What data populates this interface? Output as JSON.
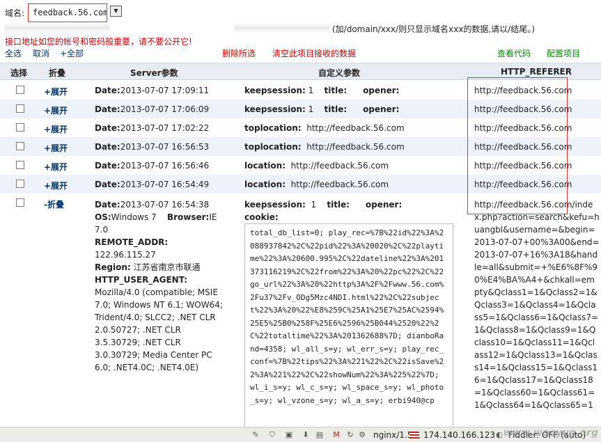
{
  "topbar": {
    "domain_label": "域名:",
    "domain_value": "feedback.56.com",
    "select_icon": "chevron-down-icon"
  },
  "api": {
    "hint": "(加/domain/xxx/则只显示域名xxx的数据,请以/结尾。)"
  },
  "warning": "接口地址如您的帐号和密码般重要，请不要公开它!",
  "actions": {
    "select_all": "全选",
    "cancel": "取消",
    "add_all": "+全部",
    "delete_selected": "删除所选",
    "clear_all": "清空此项目接收的数据",
    "view_code": "查看代码",
    "config": "配置项目"
  },
  "table": {
    "headers": [
      "选择",
      "折叠",
      "Server参数",
      "自定义参数",
      "HTTP_REFERER"
    ],
    "rows": [
      {
        "toggle": "+展开",
        "date_label": "Date:",
        "date": "2013-07-07 17:09:11",
        "custom": [
          [
            "keepsession:",
            "1"
          ],
          [
            "title:",
            ""
          ],
          [
            "opener:",
            ""
          ]
        ],
        "referer": "http://feedback.56.com"
      },
      {
        "toggle": "+展开",
        "date_label": "Date:",
        "date": "2013-07-07 17:06:09",
        "custom": [
          [
            "keepsession:",
            "1"
          ],
          [
            "title:",
            ""
          ],
          [
            "opener:",
            ""
          ]
        ],
        "referer": "http://feedback.56.com"
      },
      {
        "toggle": "+展开",
        "date_label": "Date:",
        "date": "2013-07-07 17:02:22",
        "custom": [
          [
            "toplocation:",
            "http://feedback.56.com"
          ]
        ],
        "referer": "http://feedback.56.com"
      },
      {
        "toggle": "+展开",
        "date_label": "Date:",
        "date": "2013-07-07 16:56:53",
        "custom": [
          [
            "toplocation:",
            "http://feedback.56.com"
          ]
        ],
        "referer": "http://feedback.56.com"
      },
      {
        "toggle": "+展开",
        "date_label": "Date:",
        "date": "2013-07-07 16:56:46",
        "custom": [
          [
            "location:",
            "http://feedback.56.com"
          ]
        ],
        "referer": "http://feedback.56.com"
      },
      {
        "toggle": "+展开",
        "date_label": "Date:",
        "date": "2013-07-07 16:54:49",
        "custom": [
          [
            "location:",
            "http://feedback.56.com"
          ]
        ],
        "referer": "http://feedback.56.com"
      }
    ],
    "expanded": {
      "toggle": "-折叠",
      "date_label": "Date:",
      "date": "2013-07-07 16:54:38",
      "os_label": "OS:",
      "os": "Windows 7",
      "browser_label": "Browser:",
      "browser": "IE 7.0",
      "remote_label": "REMOTE_ADDR:",
      "remote": "122.96.115.27",
      "region_label": "Region:",
      "region": "江苏省南京市联通",
      "ua_label": "HTTP_USER_AGENT:",
      "ua": "Mozilla/4.0 (compatible; MSIE 7.0; Windows NT 6.1; WOW64; Trident/4.0; SLCC2; .NET CLR 2.0.50727; .NET CLR 3.5.30729; .NET CLR 3.0.30729; Media Center PC 6.0; .NET4.0C; .NET4.0E)",
      "custom_line1": [
        [
          "keepsession:",
          "1"
        ],
        [
          "title:",
          ""
        ],
        [
          "opener:",
          ""
        ]
      ],
      "cookie_label": "cookie:",
      "cookie": "total_db_list=0; play_rec=%7B%22id%22%3A%2088937842%2C%22pid%22%3A%20020%2C%22playtime%22%3A%20600.995%2C%22dateline%22%3A%201373116219%2C%22from%22%3A%20%22pc%22%2C%22go_url%22%3A%20%22http%3A%2F%2Fwww.56.com%2Fu37%2Fv_ODg5Mzc4NDI.html%22%2C%22subject%22%3A%20%22%E8%259C%25A1%25E7%25AC%2594%25E5%25B0%258F%25E6%2596%25B044%2520%22%2C%22totaltime%22%3A%201362688%7D; dianboRand=4358; wl_all_s=y; wl_err_s=y; play_rec_conf=%7B%22tips%22%3A%221%22%2C%22isSave%22%3A%221%22%2C%22showNum%22%3A%225%22%7D; wl_i_s=y; wl_c_s=y; wl_space_s=y; wl_photo_s=y; wl_vzone_s=y; wl_a_s=y; erbi940@cp",
      "referer": "http://feedback.56.com/index.php?action=search&kefu=huangbl&username=&begin=2013-07-07+00%3A00&end=2013-07-07+16%3A18&handle=all&submit=+%E6%8F%90%E4%BA%A4+&chkall=empty&Qclass1=1&Qclass2=1&Qclass3=1&Qclass4=1&Qclass5=1&Qclass6=1&Qclass7=1&Qclass8=1&Qclass9=1&Qclass10=1&Qclass11=1&Qclass12=1&Qclass13=1&Qclass14=1&Qclass15=1&Qclass16=1&Qclass17=1&Qclass18=1&Qclass60=1&Qclass61=1&Qclass64=1&Qclass65=1"
    }
  },
  "statusbar": {
    "server": "nginx/1.5.1",
    "ip": "174.140.166.123",
    "fiddler": "Fiddler: OFF (auto)",
    "watermark": "www.wooyun.org"
  }
}
